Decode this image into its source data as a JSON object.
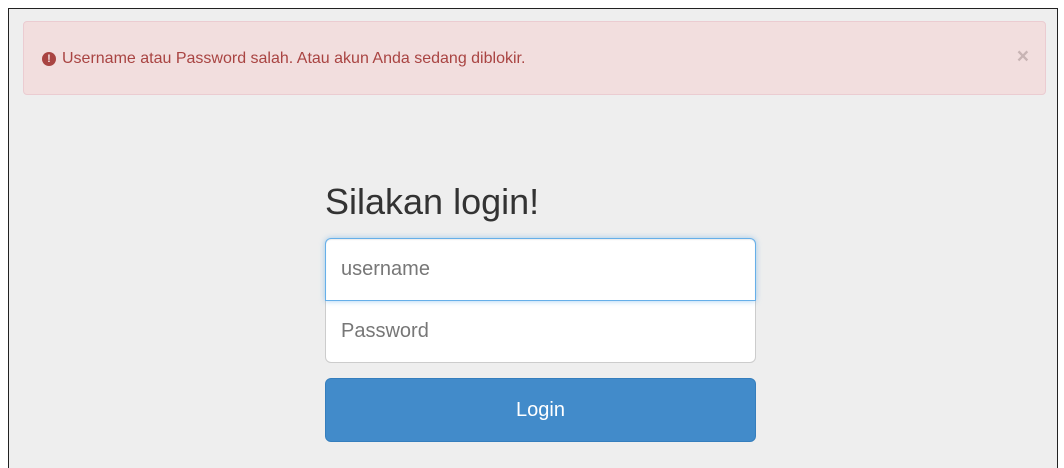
{
  "alert": {
    "icon": "exclamation-circle-icon",
    "message": "Username atau Password salah. Atau akun Anda sedang diblokir.",
    "close": "×",
    "background": "#f2dede",
    "text_color": "#a94442"
  },
  "login": {
    "title": "Silakan login!",
    "username_placeholder": "username",
    "username_value": "",
    "password_placeholder": "Password",
    "password_value": "",
    "button_label": "Login",
    "button_color": "#428bca"
  }
}
